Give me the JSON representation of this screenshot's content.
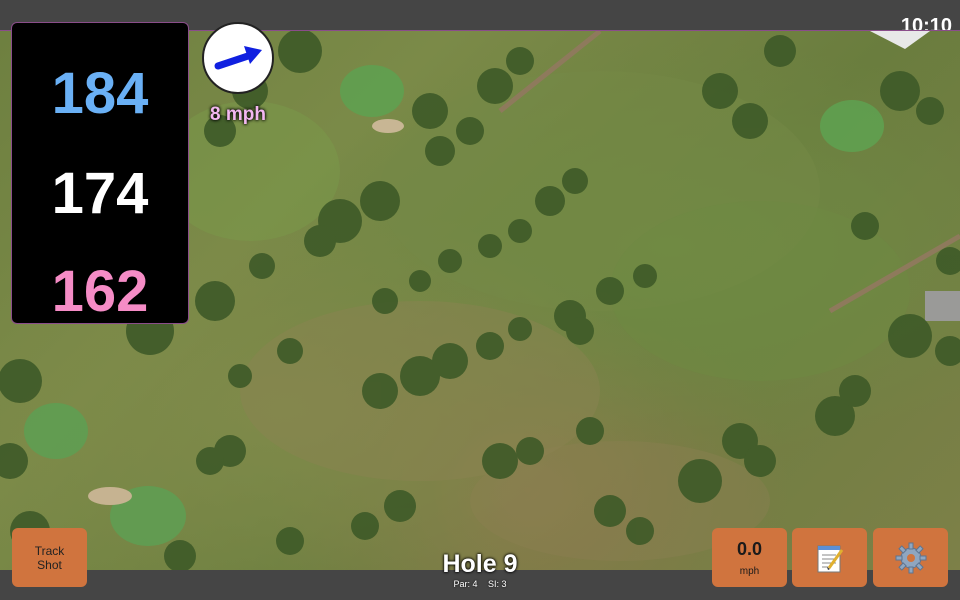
{
  "status_bar": {
    "time": "10:10"
  },
  "yardages": {
    "back": "184",
    "center": "174",
    "front": "162"
  },
  "wind": {
    "speed_label": "8 mph",
    "direction_icon": "wind-arrow-icon"
  },
  "hole": {
    "title": "Hole 9",
    "par": "Par: 4",
    "stroke_index": "SI: 3"
  },
  "buttons": {
    "track_shot_line1": "Track",
    "track_shot_line2": "Shot",
    "wind_value": "0.0",
    "wind_unit": "mph",
    "notes_icon": "notepad-icon",
    "settings_icon": "gear-icon"
  },
  "colors": {
    "back": "#6ab0f5",
    "center": "#ffffff",
    "front": "#f58cc6",
    "button": "#d0743e",
    "wind_label": "#f3b7f0"
  }
}
